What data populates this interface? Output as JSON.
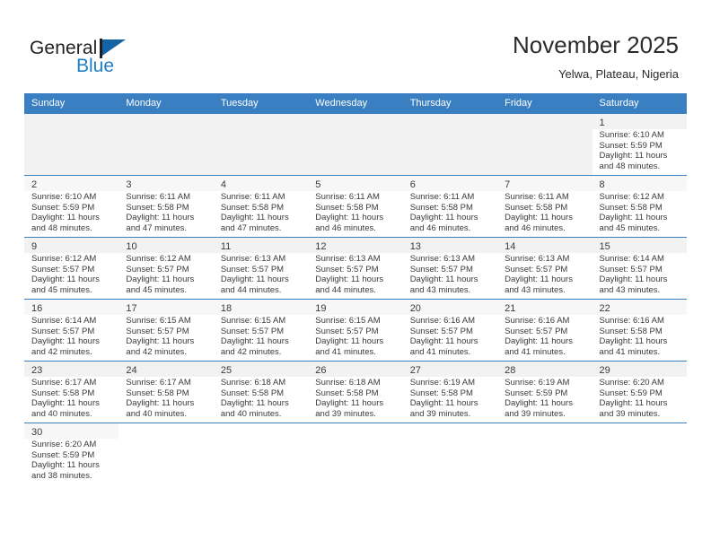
{
  "brand": {
    "name_top": "General",
    "name_bottom": "Blue",
    "flag_icon": "flag-triangle-icon",
    "color_dark": "#231f20",
    "color_blue": "#1f7fc4"
  },
  "header": {
    "title": "November 2025",
    "subtitle": "Yelwa, Plateau, Nigeria"
  },
  "theme": {
    "header_bg": "#3a7fc1",
    "header_text": "#ffffff",
    "row_band": "#f2f2f2",
    "grid_line": "#3a7fc1"
  },
  "calendar": {
    "weekday_headers": [
      "Sunday",
      "Monday",
      "Tuesday",
      "Wednesday",
      "Thursday",
      "Friday",
      "Saturday"
    ],
    "weeks": [
      [
        {
          "day": ""
        },
        {
          "day": ""
        },
        {
          "day": ""
        },
        {
          "day": ""
        },
        {
          "day": ""
        },
        {
          "day": ""
        },
        {
          "day": "1",
          "sunrise": "Sunrise: 6:10 AM",
          "sunset": "Sunset: 5:59 PM",
          "daylight1": "Daylight: 11 hours",
          "daylight2": "and 48 minutes."
        }
      ],
      [
        {
          "day": "2",
          "sunrise": "Sunrise: 6:10 AM",
          "sunset": "Sunset: 5:59 PM",
          "daylight1": "Daylight: 11 hours",
          "daylight2": "and 48 minutes."
        },
        {
          "day": "3",
          "sunrise": "Sunrise: 6:11 AM",
          "sunset": "Sunset: 5:58 PM",
          "daylight1": "Daylight: 11 hours",
          "daylight2": "and 47 minutes."
        },
        {
          "day": "4",
          "sunrise": "Sunrise: 6:11 AM",
          "sunset": "Sunset: 5:58 PM",
          "daylight1": "Daylight: 11 hours",
          "daylight2": "and 47 minutes."
        },
        {
          "day": "5",
          "sunrise": "Sunrise: 6:11 AM",
          "sunset": "Sunset: 5:58 PM",
          "daylight1": "Daylight: 11 hours",
          "daylight2": "and 46 minutes."
        },
        {
          "day": "6",
          "sunrise": "Sunrise: 6:11 AM",
          "sunset": "Sunset: 5:58 PM",
          "daylight1": "Daylight: 11 hours",
          "daylight2": "and 46 minutes."
        },
        {
          "day": "7",
          "sunrise": "Sunrise: 6:11 AM",
          "sunset": "Sunset: 5:58 PM",
          "daylight1": "Daylight: 11 hours",
          "daylight2": "and 46 minutes."
        },
        {
          "day": "8",
          "sunrise": "Sunrise: 6:12 AM",
          "sunset": "Sunset: 5:58 PM",
          "daylight1": "Daylight: 11 hours",
          "daylight2": "and 45 minutes."
        }
      ],
      [
        {
          "day": "9",
          "sunrise": "Sunrise: 6:12 AM",
          "sunset": "Sunset: 5:57 PM",
          "daylight1": "Daylight: 11 hours",
          "daylight2": "and 45 minutes."
        },
        {
          "day": "10",
          "sunrise": "Sunrise: 6:12 AM",
          "sunset": "Sunset: 5:57 PM",
          "daylight1": "Daylight: 11 hours",
          "daylight2": "and 45 minutes."
        },
        {
          "day": "11",
          "sunrise": "Sunrise: 6:13 AM",
          "sunset": "Sunset: 5:57 PM",
          "daylight1": "Daylight: 11 hours",
          "daylight2": "and 44 minutes."
        },
        {
          "day": "12",
          "sunrise": "Sunrise: 6:13 AM",
          "sunset": "Sunset: 5:57 PM",
          "daylight1": "Daylight: 11 hours",
          "daylight2": "and 44 minutes."
        },
        {
          "day": "13",
          "sunrise": "Sunrise: 6:13 AM",
          "sunset": "Sunset: 5:57 PM",
          "daylight1": "Daylight: 11 hours",
          "daylight2": "and 43 minutes."
        },
        {
          "day": "14",
          "sunrise": "Sunrise: 6:13 AM",
          "sunset": "Sunset: 5:57 PM",
          "daylight1": "Daylight: 11 hours",
          "daylight2": "and 43 minutes."
        },
        {
          "day": "15",
          "sunrise": "Sunrise: 6:14 AM",
          "sunset": "Sunset: 5:57 PM",
          "daylight1": "Daylight: 11 hours",
          "daylight2": "and 43 minutes."
        }
      ],
      [
        {
          "day": "16",
          "sunrise": "Sunrise: 6:14 AM",
          "sunset": "Sunset: 5:57 PM",
          "daylight1": "Daylight: 11 hours",
          "daylight2": "and 42 minutes."
        },
        {
          "day": "17",
          "sunrise": "Sunrise: 6:15 AM",
          "sunset": "Sunset: 5:57 PM",
          "daylight1": "Daylight: 11 hours",
          "daylight2": "and 42 minutes."
        },
        {
          "day": "18",
          "sunrise": "Sunrise: 6:15 AM",
          "sunset": "Sunset: 5:57 PM",
          "daylight1": "Daylight: 11 hours",
          "daylight2": "and 42 minutes."
        },
        {
          "day": "19",
          "sunrise": "Sunrise: 6:15 AM",
          "sunset": "Sunset: 5:57 PM",
          "daylight1": "Daylight: 11 hours",
          "daylight2": "and 41 minutes."
        },
        {
          "day": "20",
          "sunrise": "Sunrise: 6:16 AM",
          "sunset": "Sunset: 5:57 PM",
          "daylight1": "Daylight: 11 hours",
          "daylight2": "and 41 minutes."
        },
        {
          "day": "21",
          "sunrise": "Sunrise: 6:16 AM",
          "sunset": "Sunset: 5:57 PM",
          "daylight1": "Daylight: 11 hours",
          "daylight2": "and 41 minutes."
        },
        {
          "day": "22",
          "sunrise": "Sunrise: 6:16 AM",
          "sunset": "Sunset: 5:58 PM",
          "daylight1": "Daylight: 11 hours",
          "daylight2": "and 41 minutes."
        }
      ],
      [
        {
          "day": "23",
          "sunrise": "Sunrise: 6:17 AM",
          "sunset": "Sunset: 5:58 PM",
          "daylight1": "Daylight: 11 hours",
          "daylight2": "and 40 minutes."
        },
        {
          "day": "24",
          "sunrise": "Sunrise: 6:17 AM",
          "sunset": "Sunset: 5:58 PM",
          "daylight1": "Daylight: 11 hours",
          "daylight2": "and 40 minutes."
        },
        {
          "day": "25",
          "sunrise": "Sunrise: 6:18 AM",
          "sunset": "Sunset: 5:58 PM",
          "daylight1": "Daylight: 11 hours",
          "daylight2": "and 40 minutes."
        },
        {
          "day": "26",
          "sunrise": "Sunrise: 6:18 AM",
          "sunset": "Sunset: 5:58 PM",
          "daylight1": "Daylight: 11 hours",
          "daylight2": "and 39 minutes."
        },
        {
          "day": "27",
          "sunrise": "Sunrise: 6:19 AM",
          "sunset": "Sunset: 5:58 PM",
          "daylight1": "Daylight: 11 hours",
          "daylight2": "and 39 minutes."
        },
        {
          "day": "28",
          "sunrise": "Sunrise: 6:19 AM",
          "sunset": "Sunset: 5:59 PM",
          "daylight1": "Daylight: 11 hours",
          "daylight2": "and 39 minutes."
        },
        {
          "day": "29",
          "sunrise": "Sunrise: 6:20 AM",
          "sunset": "Sunset: 5:59 PM",
          "daylight1": "Daylight: 11 hours",
          "daylight2": "and 39 minutes."
        }
      ],
      [
        {
          "day": "30",
          "sunrise": "Sunrise: 6:20 AM",
          "sunset": "Sunset: 5:59 PM",
          "daylight1": "Daylight: 11 hours",
          "daylight2": "and 38 minutes."
        },
        {
          "day": ""
        },
        {
          "day": ""
        },
        {
          "day": ""
        },
        {
          "day": ""
        },
        {
          "day": ""
        },
        {
          "day": ""
        }
      ]
    ]
  }
}
